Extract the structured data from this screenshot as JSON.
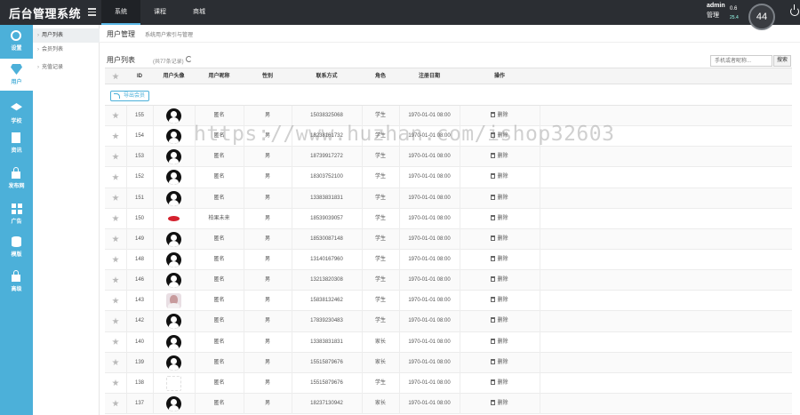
{
  "header": {
    "brand": "后台管理系统",
    "nav": [
      "系统",
      "课程",
      "商城"
    ],
    "active_nav": 0,
    "admin_name": "admin",
    "admin_role": "管理",
    "speed_up": "0.6",
    "speed_down": "25.4",
    "gauge_value": "44"
  },
  "sidebar": {
    "items": [
      {
        "label": "设置",
        "icon": "gear-icon"
      },
      {
        "label": "用户",
        "icon": "diamond-icon",
        "active": true
      },
      {
        "label": "学校",
        "icon": "graduation-cap-icon"
      },
      {
        "label": "资讯",
        "icon": "document-icon"
      },
      {
        "label": "发布网",
        "icon": "lock-icon"
      },
      {
        "label": "广告",
        "icon": "grid-icon"
      },
      {
        "label": "模版",
        "icon": "database-icon"
      },
      {
        "label": "高级",
        "icon": "lock-icon"
      }
    ]
  },
  "subsidebar": {
    "items": [
      "用户列表",
      "会员列表",
      "充值记录"
    ],
    "active": 0
  },
  "page": {
    "title": "用户管理",
    "description": "系统用户索引与管理",
    "list_title": "用户列表",
    "list_count": "(共77条记录)",
    "search_placeholder": "手机或者昵称...",
    "search_button": "搜索",
    "export_button": "导出会员"
  },
  "table": {
    "headers": [
      "",
      "ID",
      "用户头像",
      "用户昵称",
      "性别",
      "联系方式",
      "角色",
      "注册日期",
      "操作"
    ],
    "delete_label": "删除",
    "rows": [
      {
        "id": "155",
        "avatar": "default",
        "nickname": "匿名",
        "gender": "男",
        "phone": "15038325068",
        "role": "学生",
        "date": "1970-01-01 08:00"
      },
      {
        "id": "154",
        "avatar": "default",
        "nickname": "匿名",
        "gender": "男",
        "phone": "18238161732",
        "role": "学生",
        "date": "1970-01-01 08:00"
      },
      {
        "id": "153",
        "avatar": "default",
        "nickname": "匿名",
        "gender": "男",
        "phone": "18739917272",
        "role": "学生",
        "date": "1970-01-01 08:00"
      },
      {
        "id": "152",
        "avatar": "default",
        "nickname": "匿名",
        "gender": "男",
        "phone": "18303752100",
        "role": "学生",
        "date": "1970-01-01 08:00"
      },
      {
        "id": "151",
        "avatar": "default",
        "nickname": "匿名",
        "gender": "男",
        "phone": "13383831831",
        "role": "学生",
        "date": "1970-01-01 08:00"
      },
      {
        "id": "150",
        "avatar": "lips",
        "nickname": "柏果未来",
        "gender": "男",
        "phone": "18539039057",
        "role": "学生",
        "date": "1970-01-01 08:00"
      },
      {
        "id": "149",
        "avatar": "default",
        "nickname": "匿名",
        "gender": "男",
        "phone": "18530087148",
        "role": "学生",
        "date": "1970-01-01 08:00"
      },
      {
        "id": "148",
        "avatar": "default",
        "nickname": "匿名",
        "gender": "男",
        "phone": "13140167960",
        "role": "学生",
        "date": "1970-01-01 08:00"
      },
      {
        "id": "146",
        "avatar": "default",
        "nickname": "匿名",
        "gender": "男",
        "phone": "13213820308",
        "role": "学生",
        "date": "1970-01-01 08:00"
      },
      {
        "id": "143",
        "avatar": "photo",
        "nickname": "匿名",
        "gender": "男",
        "phone": "15838132462",
        "role": "学生",
        "date": "1970-01-01 08:00"
      },
      {
        "id": "142",
        "avatar": "default",
        "nickname": "匿名",
        "gender": "男",
        "phone": "17839230483",
        "role": "学生",
        "date": "1970-01-01 08:00"
      },
      {
        "id": "140",
        "avatar": "default",
        "nickname": "匿名",
        "gender": "男",
        "phone": "13383831831",
        "role": "家长",
        "date": "1970-01-01 08:00"
      },
      {
        "id": "139",
        "avatar": "default",
        "nickname": "匿名",
        "gender": "男",
        "phone": "15515879676",
        "role": "家长",
        "date": "1970-01-01 08:00"
      },
      {
        "id": "138",
        "avatar": "blank",
        "nickname": "匿名",
        "gender": "男",
        "phone": "15515879676",
        "role": "学生",
        "date": "1970-01-01 08:00"
      },
      {
        "id": "137",
        "avatar": "default",
        "nickname": "匿名",
        "gender": "男",
        "phone": "18237130942",
        "role": "家长",
        "date": "1970-01-01 08:00"
      }
    ]
  },
  "watermark": "https://www.huzhan.com/ishop32603"
}
